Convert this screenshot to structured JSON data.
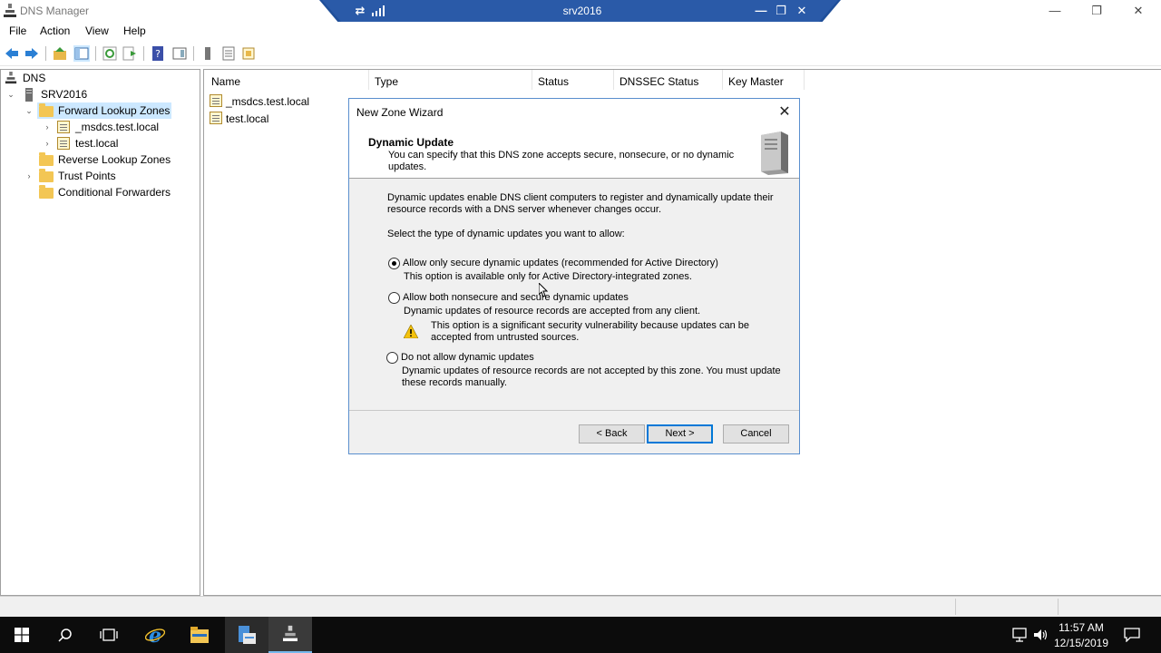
{
  "window": {
    "title": "DNS Manager",
    "min_icon": "minimize-icon",
    "max_icon": "maximize-icon",
    "close_icon": "close-icon"
  },
  "rdp": {
    "title": "srv2016",
    "pin_icon": "pin-icon",
    "signal_icon": "signal-icon"
  },
  "menu": {
    "file": "File",
    "action": "Action",
    "view": "View",
    "help": "Help"
  },
  "tree": {
    "root": "DNS",
    "server": "SRV2016",
    "forward": "Forward Lookup Zones",
    "zone1": "_msdcs.test.local",
    "zone2": "test.local",
    "reverse": "Reverse Lookup Zones",
    "trust": "Trust Points",
    "conditional": "Conditional Forwarders"
  },
  "list": {
    "columns": [
      "Name",
      "Type",
      "Status",
      "DNSSEC Status",
      "Key Master"
    ],
    "rows": [
      "_msdcs.test.local",
      "test.local"
    ]
  },
  "dialog": {
    "title": "New Zone Wizard",
    "header_title": "Dynamic Update",
    "header_sub": "You can specify that this DNS zone accepts secure, nonsecure, or no dynamic updates.",
    "intro": "Dynamic updates enable DNS client computers to register and dynamically update their resource records with a DNS server whenever changes occur.",
    "prompt": "Select the type of dynamic updates you want to allow:",
    "opt1_label": "Allow only secure dynamic updates (recommended for Active Directory)",
    "opt1_desc": "This option is available only for Active Directory-integrated zones.",
    "opt2_label": "Allow both nonsecure and secure dynamic updates",
    "opt2_desc": "Dynamic updates of resource records are accepted from any client.",
    "opt2_warning": "This option is a significant security vulnerability because updates can be accepted from untrusted sources.",
    "opt3_label": "Do not allow dynamic updates",
    "opt3_desc": "Dynamic updates of resource records are not accepted by this zone. You must update these records manually.",
    "selected": "opt1",
    "back": "< Back",
    "next": "Next >",
    "cancel": "Cancel"
  },
  "taskbar": {
    "time": "11:57 AM",
    "date": "12/15/2019"
  },
  "colors": {
    "accent": "#0078d7",
    "rdp_bar": "#2a5aa8",
    "selection": "#cce8ff",
    "taskbar": "#0c0c0c"
  }
}
